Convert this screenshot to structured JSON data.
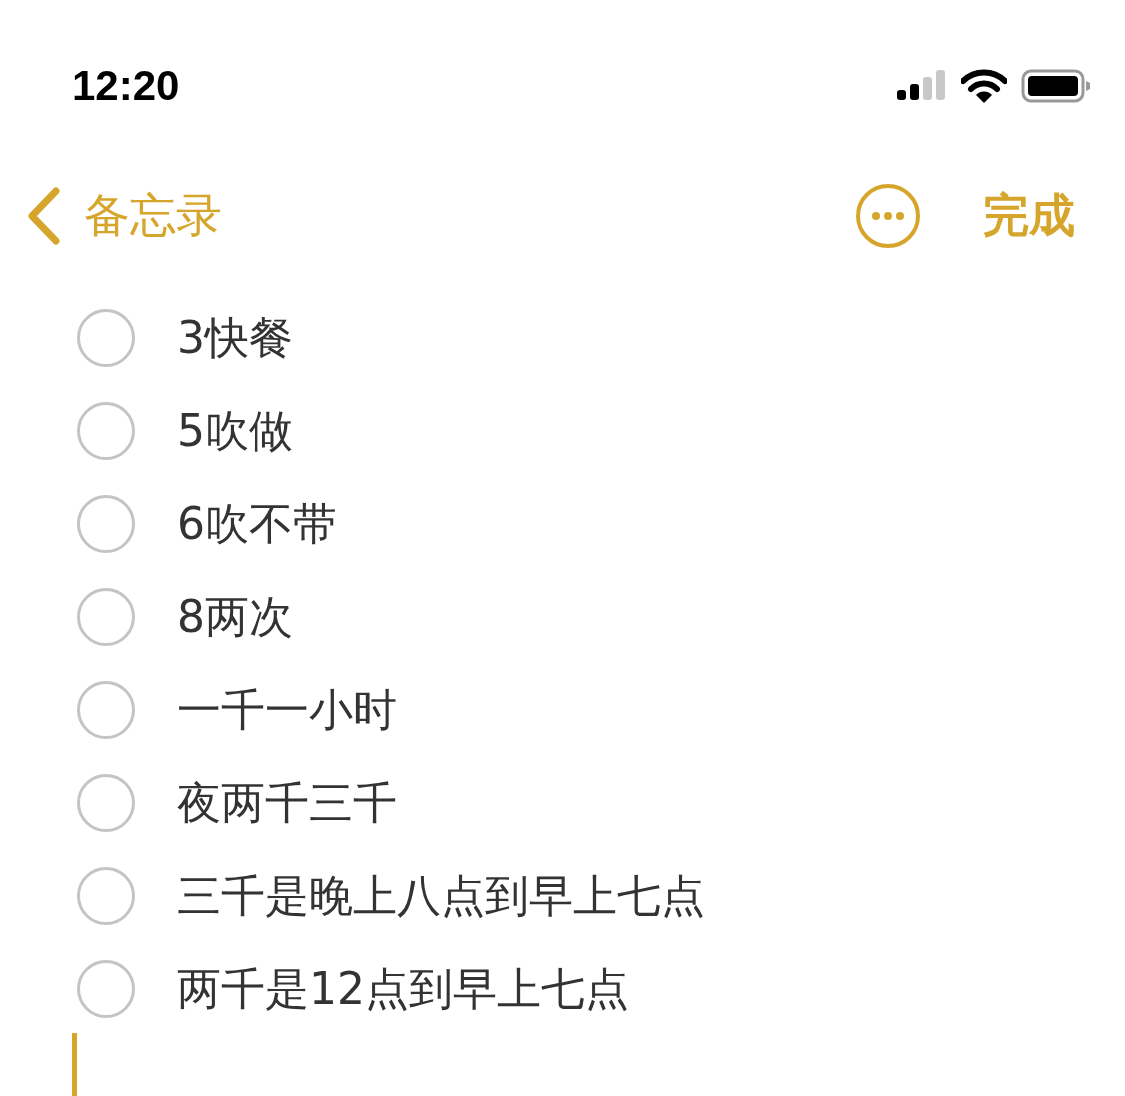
{
  "status_bar": {
    "time": "12:20"
  },
  "nav": {
    "back_label": "备忘录",
    "done_label": "完成"
  },
  "note": {
    "checklist": [
      {
        "text": "3快餐",
        "checked": false
      },
      {
        "text": "5吹做",
        "checked": false
      },
      {
        "text": "6吹不带",
        "checked": false
      },
      {
        "text": "8两次",
        "checked": false
      },
      {
        "text": "一千一小时",
        "checked": false
      },
      {
        "text": "夜两千三千",
        "checked": false
      },
      {
        "text": "三千是晚上八点到早上七点",
        "checked": false
      },
      {
        "text": "两千是12点到早上七点",
        "checked": false
      }
    ]
  }
}
